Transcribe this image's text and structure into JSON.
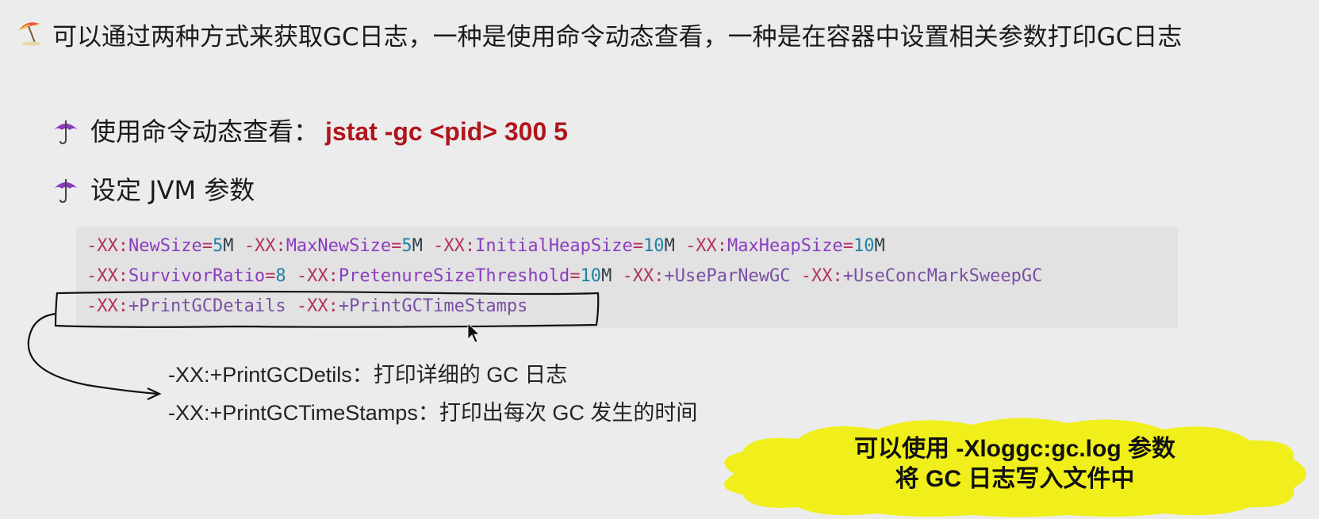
{
  "main_point": {
    "text": "可以通过两种方式来获取GC日志，一种是使用命令动态查看，一种是在容器中设置相关参数打印GC日志"
  },
  "items": [
    {
      "label": "使用命令动态查看：",
      "command": "jstat -gc <pid> 300 5"
    },
    {
      "label": "设定 JVM 参数"
    }
  ],
  "code": {
    "lines": [
      [
        {
          "t": "-XX:",
          "c": "k"
        },
        {
          "t": "NewSize",
          "c": "o"
        },
        {
          "t": "=",
          "c": "k"
        },
        {
          "t": "5",
          "c": "n"
        },
        {
          "t": "M ",
          "c": "g"
        },
        {
          "t": "-XX:",
          "c": "k"
        },
        {
          "t": "MaxNewSize",
          "c": "o"
        },
        {
          "t": "=",
          "c": "k"
        },
        {
          "t": "5",
          "c": "n"
        },
        {
          "t": "M ",
          "c": "g"
        },
        {
          "t": "-XX:",
          "c": "k"
        },
        {
          "t": "InitialHeapSize",
          "c": "o"
        },
        {
          "t": "=",
          "c": "k"
        },
        {
          "t": "10",
          "c": "n"
        },
        {
          "t": "M ",
          "c": "g"
        },
        {
          "t": "-XX:",
          "c": "k"
        },
        {
          "t": "MaxHeapSize",
          "c": "o"
        },
        {
          "t": "=",
          "c": "k"
        },
        {
          "t": "10",
          "c": "n"
        },
        {
          "t": "M",
          "c": "g"
        }
      ],
      [
        {
          "t": "-XX:",
          "c": "k"
        },
        {
          "t": "SurvivorRatio",
          "c": "o"
        },
        {
          "t": "=",
          "c": "k"
        },
        {
          "t": "8",
          "c": "n"
        },
        {
          "t": " ",
          "c": "g"
        },
        {
          "t": "-XX:",
          "c": "k"
        },
        {
          "t": "PretenureSizeThreshold",
          "c": "o"
        },
        {
          "t": "=",
          "c": "k"
        },
        {
          "t": "10",
          "c": "n"
        },
        {
          "t": "M ",
          "c": "g"
        },
        {
          "t": "-XX:",
          "c": "k"
        },
        {
          "t": "+UseParNewGC",
          "c": "p"
        },
        {
          "t": " ",
          "c": "g"
        },
        {
          "t": "-XX:",
          "c": "k"
        },
        {
          "t": "+UseConcMarkSweepGC",
          "c": "p"
        }
      ],
      [
        {
          "t": "-XX:",
          "c": "k"
        },
        {
          "t": "+PrintGCDetails",
          "c": "p"
        },
        {
          "t": " ",
          "c": "g"
        },
        {
          "t": "-XX:",
          "c": "k"
        },
        {
          "t": "+PrintGCTimeStamps",
          "c": "p"
        }
      ]
    ]
  },
  "notes": [
    "-XX:+PrintGCDetils：打印详细的 GC 日志",
    "-XX:+PrintGCTimeStamps：打印出每次 GC 发生的时间"
  ],
  "callout": {
    "line1": "可以使用 -Xloggc:gc.log 参数",
    "line2": "将 GC 日志写入文件中",
    "color": "#f0ef1c"
  }
}
